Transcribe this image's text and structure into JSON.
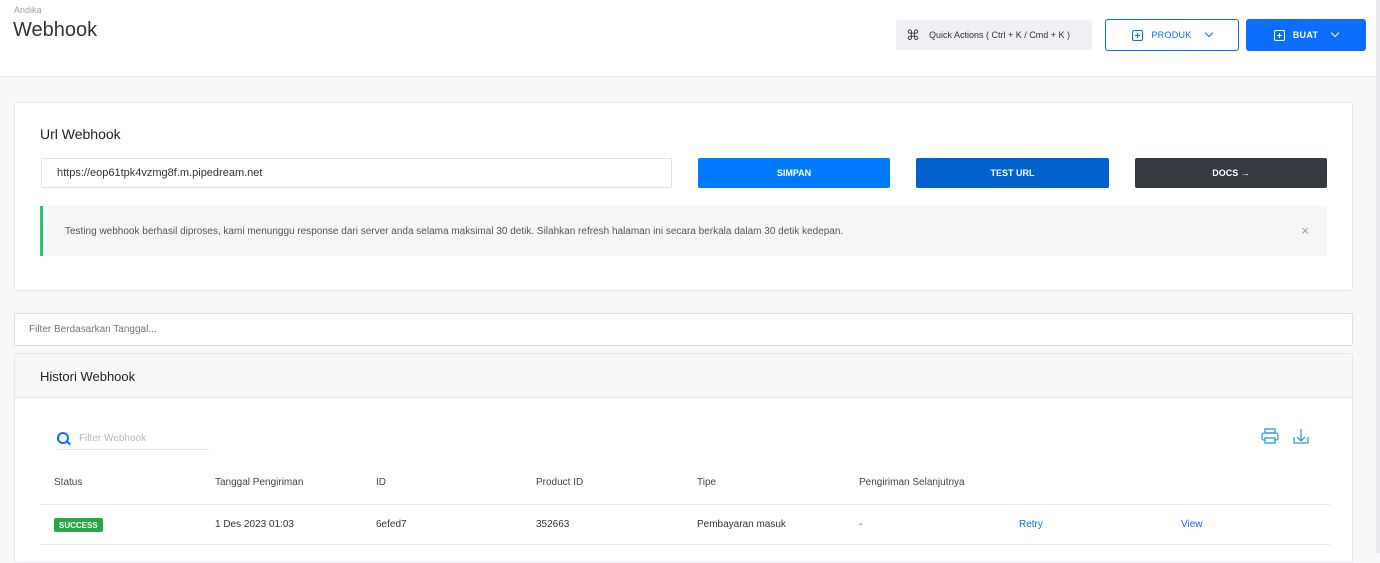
{
  "header": {
    "breadcrumb": "Andika",
    "title": "Webhook",
    "quick_actions": "Quick Actions ( Ctrl + K / Cmd + K )",
    "produk_label": "PRODUK",
    "buat_label": "BUAT"
  },
  "url_card": {
    "title": "Url Webhook",
    "url_value": "https://eop61tpk4vzmg8f.m.pipedream.net",
    "simpan_label": "SIMPAN",
    "test_label": "TEST URL",
    "docs_label": "DOCS →",
    "alert_text": "Testing webhook berhasil diproses, kami menunggu response dari server anda selama maksimal 30 detik. Silahkan refresh halaman ini secara berkala dalam 30 detik kedepan.",
    "alert_close": "×"
  },
  "filter": {
    "placeholder": "Filter Berdasarkan Tanggal..."
  },
  "history": {
    "title": "Histori Webhook",
    "search_placeholder": "Filter Webhook",
    "columns": [
      "Status",
      "Tanggal Pengiriman",
      "ID",
      "Product ID",
      "Tipe",
      "Pengiriman Selanjutnya"
    ],
    "rows": [
      {
        "status": "SUCCESS",
        "tanggal": "1 Des 2023 01:03",
        "id": "6efed7",
        "product_id": "352663",
        "tipe": "Pembayaran masuk",
        "selanjutnya": "-",
        "retry": "Retry",
        "view": "View"
      }
    ]
  },
  "colors": {
    "primary": "#0d6efd",
    "success": "#28a745",
    "dark": "#343a40"
  }
}
